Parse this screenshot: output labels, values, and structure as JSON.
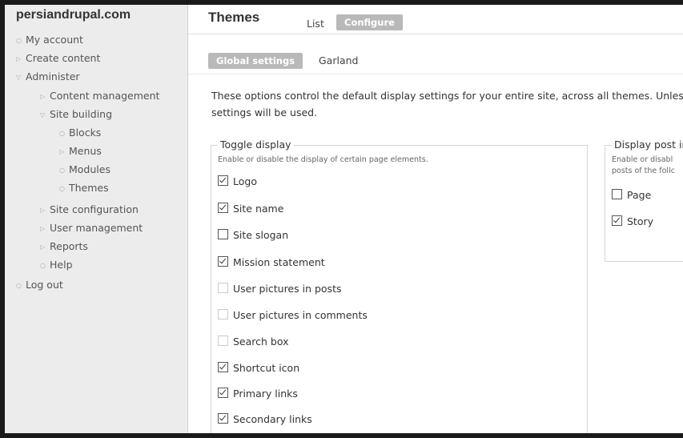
{
  "sidebar": {
    "site_name": "persiandrupal.com",
    "items": [
      {
        "label": "My account"
      },
      {
        "label": "Create content"
      },
      {
        "label": "Administer"
      },
      {
        "label": "Content management"
      },
      {
        "label": "Site building"
      },
      {
        "label": "Blocks"
      },
      {
        "label": "Menus"
      },
      {
        "label": "Modules"
      },
      {
        "label": "Themes"
      },
      {
        "label": "Site configuration"
      },
      {
        "label": "User management"
      },
      {
        "label": "Reports"
      },
      {
        "label": "Help"
      },
      {
        "label": "Log out"
      }
    ]
  },
  "header": {
    "title": "Themes",
    "tabs": [
      {
        "label": "List"
      },
      {
        "label": "Configure"
      }
    ],
    "subtabs": [
      {
        "label": "Global settings"
      },
      {
        "label": "Garland"
      }
    ]
  },
  "description": "These options control the default display settings for your entire site, across all themes. Unless settings will be used.",
  "toggle_display": {
    "legend": "Toggle display",
    "description": "Enable or disable the display of certain page elements.",
    "options": [
      {
        "label": "Logo",
        "checked": true,
        "disabled": false
      },
      {
        "label": "Site name",
        "checked": true,
        "disabled": false
      },
      {
        "label": "Site slogan",
        "checked": false,
        "disabled": false
      },
      {
        "label": "Mission statement",
        "checked": true,
        "disabled": false
      },
      {
        "label": "User pictures in posts",
        "checked": false,
        "disabled": true
      },
      {
        "label": "User pictures in comments",
        "checked": false,
        "disabled": true
      },
      {
        "label": "Search box",
        "checked": false,
        "disabled": true
      },
      {
        "label": "Shortcut icon",
        "checked": true,
        "disabled": false
      },
      {
        "label": "Primary links",
        "checked": true,
        "disabled": false
      },
      {
        "label": "Secondary links",
        "checked": true,
        "disabled": false
      }
    ]
  },
  "display_post": {
    "legend": "Display post ir",
    "description_line1": "Enable or disabl",
    "description_line2": "posts of the follc",
    "options": [
      {
        "label": "Page",
        "checked": false,
        "disabled": false
      },
      {
        "label": "Story",
        "checked": true,
        "disabled": false
      }
    ]
  }
}
